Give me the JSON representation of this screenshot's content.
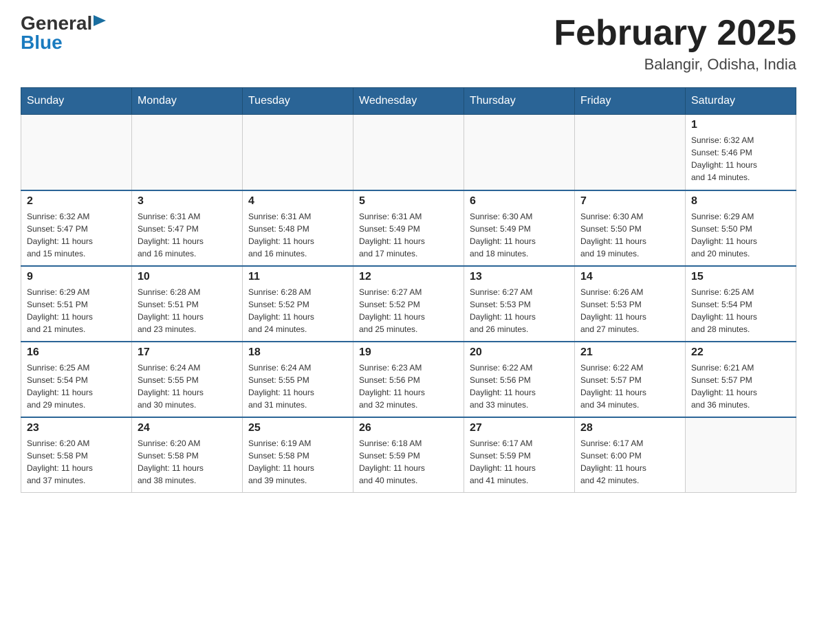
{
  "logo": {
    "general": "General",
    "blue": "Blue"
  },
  "title": "February 2025",
  "location": "Balangir, Odisha, India",
  "days_of_week": [
    "Sunday",
    "Monday",
    "Tuesday",
    "Wednesday",
    "Thursday",
    "Friday",
    "Saturday"
  ],
  "weeks": [
    [
      {
        "day": "",
        "info": ""
      },
      {
        "day": "",
        "info": ""
      },
      {
        "day": "",
        "info": ""
      },
      {
        "day": "",
        "info": ""
      },
      {
        "day": "",
        "info": ""
      },
      {
        "day": "",
        "info": ""
      },
      {
        "day": "1",
        "info": "Sunrise: 6:32 AM\nSunset: 5:46 PM\nDaylight: 11 hours\nand 14 minutes."
      }
    ],
    [
      {
        "day": "2",
        "info": "Sunrise: 6:32 AM\nSunset: 5:47 PM\nDaylight: 11 hours\nand 15 minutes."
      },
      {
        "day": "3",
        "info": "Sunrise: 6:31 AM\nSunset: 5:47 PM\nDaylight: 11 hours\nand 16 minutes."
      },
      {
        "day": "4",
        "info": "Sunrise: 6:31 AM\nSunset: 5:48 PM\nDaylight: 11 hours\nand 16 minutes."
      },
      {
        "day": "5",
        "info": "Sunrise: 6:31 AM\nSunset: 5:49 PM\nDaylight: 11 hours\nand 17 minutes."
      },
      {
        "day": "6",
        "info": "Sunrise: 6:30 AM\nSunset: 5:49 PM\nDaylight: 11 hours\nand 18 minutes."
      },
      {
        "day": "7",
        "info": "Sunrise: 6:30 AM\nSunset: 5:50 PM\nDaylight: 11 hours\nand 19 minutes."
      },
      {
        "day": "8",
        "info": "Sunrise: 6:29 AM\nSunset: 5:50 PM\nDaylight: 11 hours\nand 20 minutes."
      }
    ],
    [
      {
        "day": "9",
        "info": "Sunrise: 6:29 AM\nSunset: 5:51 PM\nDaylight: 11 hours\nand 21 minutes."
      },
      {
        "day": "10",
        "info": "Sunrise: 6:28 AM\nSunset: 5:51 PM\nDaylight: 11 hours\nand 23 minutes."
      },
      {
        "day": "11",
        "info": "Sunrise: 6:28 AM\nSunset: 5:52 PM\nDaylight: 11 hours\nand 24 minutes."
      },
      {
        "day": "12",
        "info": "Sunrise: 6:27 AM\nSunset: 5:52 PM\nDaylight: 11 hours\nand 25 minutes."
      },
      {
        "day": "13",
        "info": "Sunrise: 6:27 AM\nSunset: 5:53 PM\nDaylight: 11 hours\nand 26 minutes."
      },
      {
        "day": "14",
        "info": "Sunrise: 6:26 AM\nSunset: 5:53 PM\nDaylight: 11 hours\nand 27 minutes."
      },
      {
        "day": "15",
        "info": "Sunrise: 6:25 AM\nSunset: 5:54 PM\nDaylight: 11 hours\nand 28 minutes."
      }
    ],
    [
      {
        "day": "16",
        "info": "Sunrise: 6:25 AM\nSunset: 5:54 PM\nDaylight: 11 hours\nand 29 minutes."
      },
      {
        "day": "17",
        "info": "Sunrise: 6:24 AM\nSunset: 5:55 PM\nDaylight: 11 hours\nand 30 minutes."
      },
      {
        "day": "18",
        "info": "Sunrise: 6:24 AM\nSunset: 5:55 PM\nDaylight: 11 hours\nand 31 minutes."
      },
      {
        "day": "19",
        "info": "Sunrise: 6:23 AM\nSunset: 5:56 PM\nDaylight: 11 hours\nand 32 minutes."
      },
      {
        "day": "20",
        "info": "Sunrise: 6:22 AM\nSunset: 5:56 PM\nDaylight: 11 hours\nand 33 minutes."
      },
      {
        "day": "21",
        "info": "Sunrise: 6:22 AM\nSunset: 5:57 PM\nDaylight: 11 hours\nand 34 minutes."
      },
      {
        "day": "22",
        "info": "Sunrise: 6:21 AM\nSunset: 5:57 PM\nDaylight: 11 hours\nand 36 minutes."
      }
    ],
    [
      {
        "day": "23",
        "info": "Sunrise: 6:20 AM\nSunset: 5:58 PM\nDaylight: 11 hours\nand 37 minutes."
      },
      {
        "day": "24",
        "info": "Sunrise: 6:20 AM\nSunset: 5:58 PM\nDaylight: 11 hours\nand 38 minutes."
      },
      {
        "day": "25",
        "info": "Sunrise: 6:19 AM\nSunset: 5:58 PM\nDaylight: 11 hours\nand 39 minutes."
      },
      {
        "day": "26",
        "info": "Sunrise: 6:18 AM\nSunset: 5:59 PM\nDaylight: 11 hours\nand 40 minutes."
      },
      {
        "day": "27",
        "info": "Sunrise: 6:17 AM\nSunset: 5:59 PM\nDaylight: 11 hours\nand 41 minutes."
      },
      {
        "day": "28",
        "info": "Sunrise: 6:17 AM\nSunset: 6:00 PM\nDaylight: 11 hours\nand 42 minutes."
      },
      {
        "day": "",
        "info": ""
      }
    ]
  ]
}
